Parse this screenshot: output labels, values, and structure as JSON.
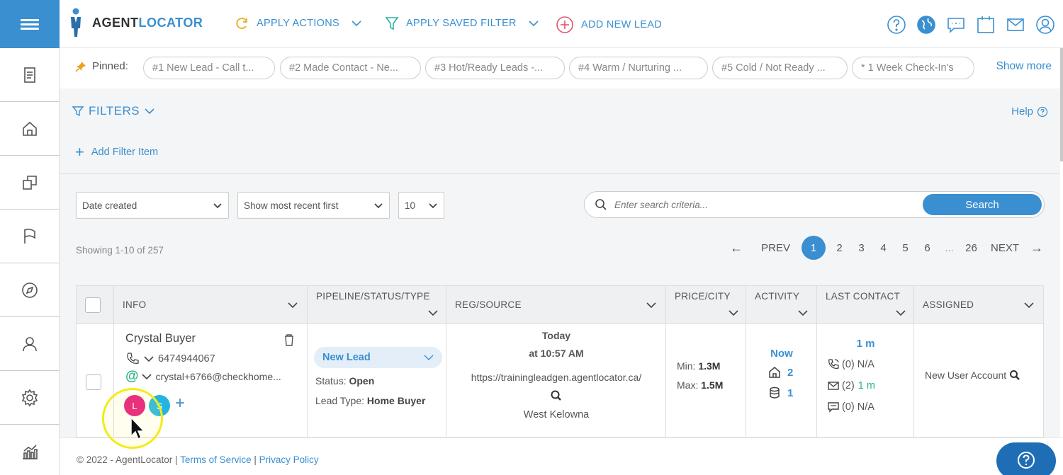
{
  "app": {
    "brand_primary": "AGENT",
    "brand_secondary": "LOCATOR",
    "accent_color": "#3a8fd0"
  },
  "topnav": {
    "apply_actions": "APPLY ACTIONS",
    "apply_saved_filter": "APPLY SAVED FILTER",
    "add_new_lead": "ADD NEW LEAD"
  },
  "pinned": {
    "label": "Pinned:",
    "chips": [
      "#1 New Lead - Call t...",
      "#2 Made Contact - Ne...",
      "#3 Hot/Ready Leads -...",
      "#4 Warm / Nurturing ...",
      "#5 Cold / Not Ready ...",
      "* 1 Week Check-In's"
    ],
    "show_more": "Show more"
  },
  "filters": {
    "title": "FILTERS",
    "help": "Help",
    "add_filter": "Add Filter Item"
  },
  "controls": {
    "sort_field": "Date created",
    "sort_order": "Show most recent first",
    "per_page": "10",
    "search_placeholder": "Enter search criteria...",
    "search_button": "Search"
  },
  "results": {
    "showing": "Showing 1-10 of 257"
  },
  "pager": {
    "prev": "PREV",
    "next": "NEXT",
    "pages": [
      "2",
      "3",
      "4",
      "5",
      "6"
    ],
    "current": "1",
    "ellipsis": "...",
    "last": "26"
  },
  "table": {
    "columns": [
      "INFO",
      "PIPELINE/STATUS/TYPE",
      "REG/SOURCE",
      "PRICE/CITY",
      "ACTIVITY",
      "LAST CONTACT",
      "ASSIGNED"
    ],
    "row": {
      "name": "Crystal Buyer",
      "phone": "6474944067",
      "email": "crystal+6766@checkhome...",
      "avatars": [
        "L",
        "S"
      ],
      "pipeline": "New Lead",
      "status_label": "Status:",
      "status_value": "Open",
      "lead_type_label": "Lead Type:",
      "lead_type_value": "Home Buyer",
      "reg_day": "Today",
      "reg_time": "at 10:57 AM",
      "source": "https://trainingleadgen.agentlocator.ca/",
      "city": "West Kelowna",
      "min_label": "Min:",
      "min_value": "1.3M",
      "max_label": "Max:",
      "max_value": "1.5M",
      "activity_now": "Now",
      "activity_homes": "2",
      "activity_db": "1",
      "last_contact_time": "1 m",
      "call_count": "(0) N/A",
      "email_count": "(2)",
      "email_time": "1 m",
      "sms_count": "(0) N/A",
      "assigned": "New User Account"
    }
  },
  "footer": {
    "copyright": "© 2022 - AgentLocator |",
    "terms": "Terms of Service",
    "sep": "|",
    "privacy": "Privacy Policy"
  }
}
